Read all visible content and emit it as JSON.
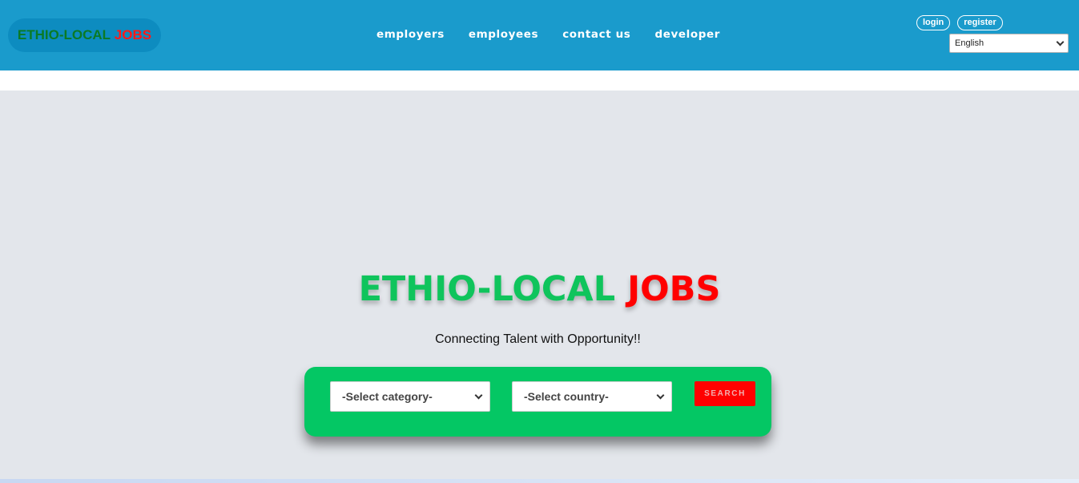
{
  "header": {
    "logo": {
      "part1": "ETHIO-LOCAL",
      "part2": "JOBS"
    },
    "nav": [
      "employers",
      "employees",
      "contact us",
      "developer"
    ],
    "login_label": "login",
    "register_label": "register",
    "language_selected": "English"
  },
  "hero": {
    "title_part1": "ETHIO-LOCAL",
    "title_part2": "JOBS",
    "tagline": "Connecting Talent with Opportunity!!",
    "category_placeholder": "-Select category-",
    "country_placeholder": "-Select country-",
    "search_label": "SEARCH"
  },
  "colors": {
    "header_bg": "#1a9bcc",
    "brand_green": "#0fc45c",
    "brand_red": "#ff0000",
    "search_card": "#04c764",
    "hero_bg": "#e3e6eb"
  },
  "icons": {
    "select_arrow": "chevron-down-icon"
  }
}
